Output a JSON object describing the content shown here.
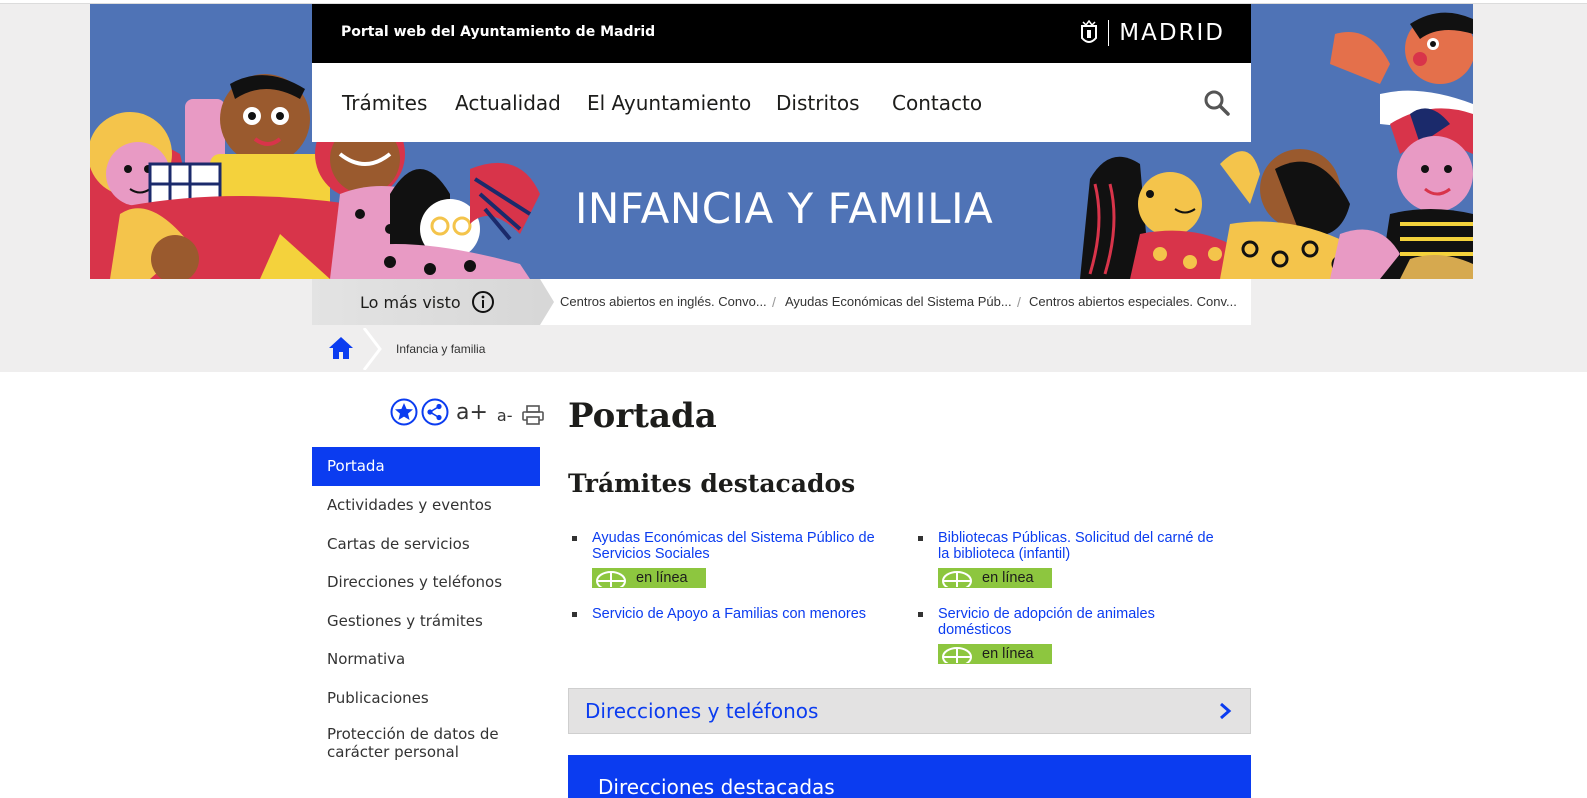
{
  "header": {
    "portal_title": "Portal web del Ayuntamiento de Madrid",
    "brand": "MADRID",
    "nav": [
      "Trámites",
      "Actualidad",
      "El Ayuntamiento",
      "Distritos",
      "Contacto"
    ],
    "search_icon": "search-icon"
  },
  "hero": {
    "title": "INFANCIA Y FAMILIA"
  },
  "most_viewed": {
    "label": "Lo más visto",
    "links": [
      "Centros abiertos en inglés. Convo...",
      "Ayudas Económicas del Sistema Púb...",
      "Centros abiertos especiales. Conv..."
    ],
    "separator": "/"
  },
  "breadcrumb": {
    "current": "Infancia y familia"
  },
  "tools": {
    "increase_font": "a+",
    "decrease_font": "a-"
  },
  "sidebar": {
    "items": [
      {
        "label": "Portada",
        "active": true
      },
      {
        "label": "Actividades y eventos"
      },
      {
        "label": "Cartas de servicios"
      },
      {
        "label": "Direcciones y teléfonos"
      },
      {
        "label": "Gestiones y trámites"
      },
      {
        "label": "Normativa"
      },
      {
        "label": "Publicaciones"
      },
      {
        "label": "Protección de datos de carácter personal"
      }
    ]
  },
  "main": {
    "page_title": "Portada",
    "section_title": "Trámites destacados",
    "tramites": [
      {
        "label": "Ayudas Económicas del Sistema Público de Servicios Sociales",
        "online": true
      },
      {
        "label": "Bibliotecas Públicas. Solicitud del carné de la biblioteca (infantil)",
        "online": true
      },
      {
        "label": "Servicio de Apoyo a Familias con menores",
        "online": false
      },
      {
        "label": "Servicio de adopción de animales domésticos",
        "online": true
      }
    ],
    "online_label": "en línea",
    "directions_bar": "Direcciones y teléfonos",
    "featured_box": "Direcciones destacadas"
  },
  "colors": {
    "accent_blue": "#0b3cf0",
    "online_green": "#8dc63f",
    "hero_blue": "#4f73b6"
  }
}
